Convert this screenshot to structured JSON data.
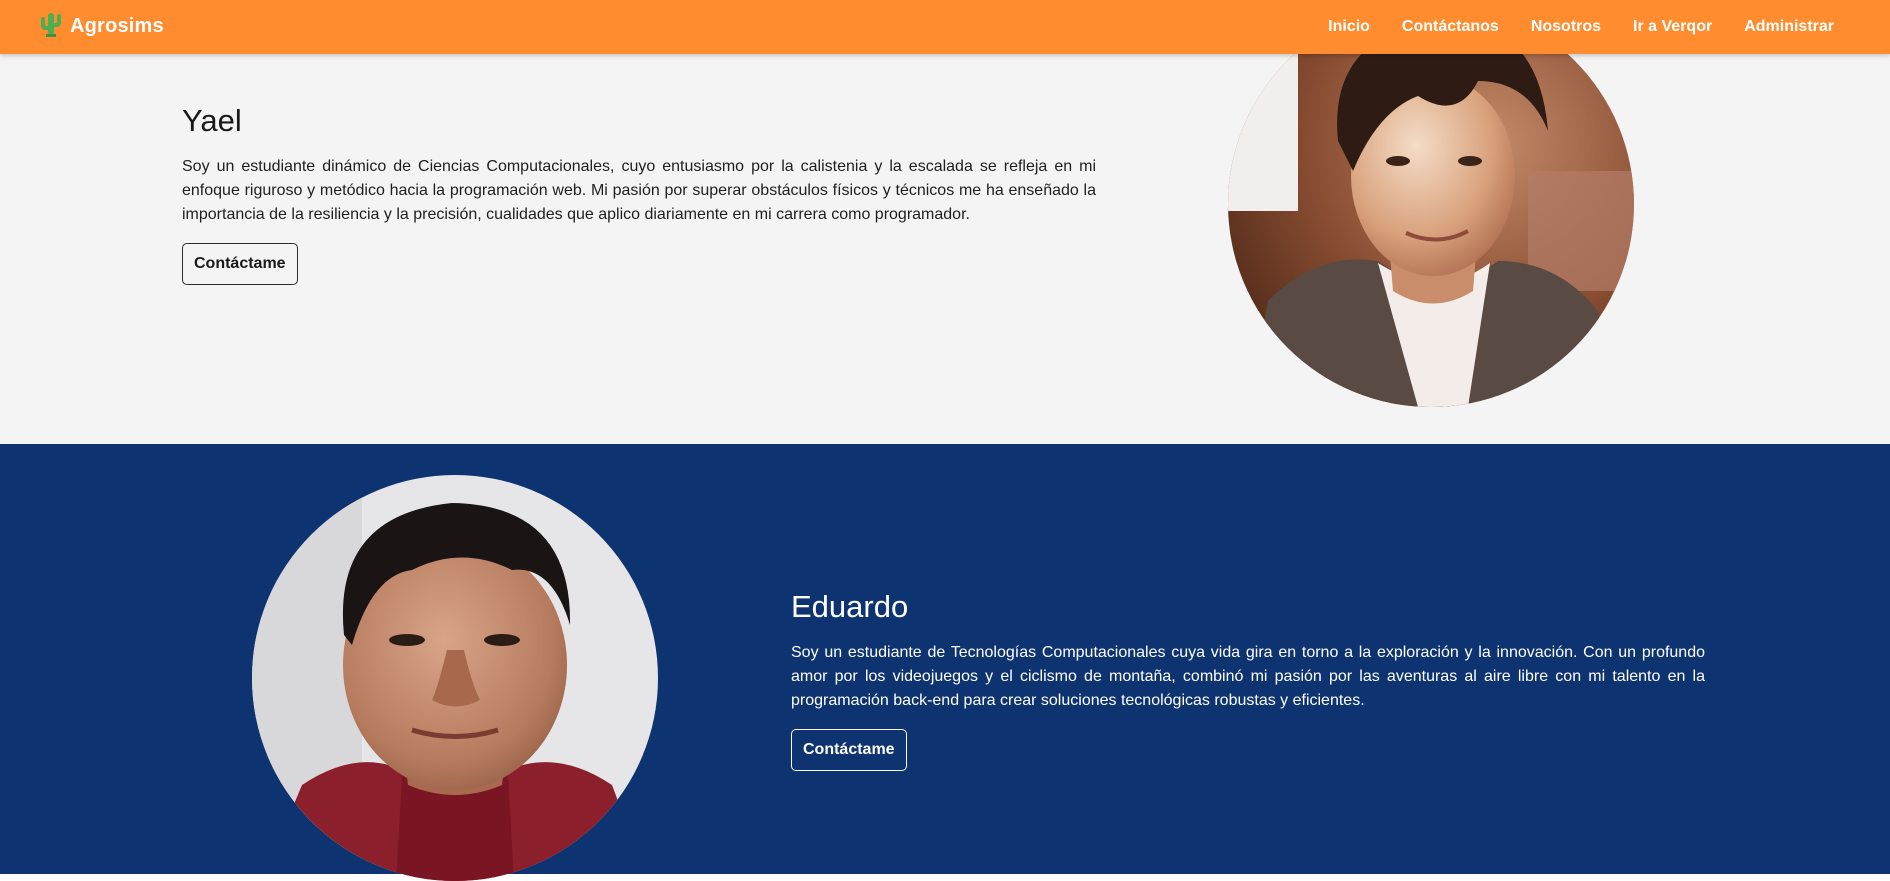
{
  "navbar": {
    "brand": "Agrosims",
    "brand_icon": "cactus-icon",
    "links": [
      "Inicio",
      "Contáctanos",
      "Nosotros",
      "Ir a Verqor",
      "Administrar"
    ]
  },
  "team": [
    {
      "name": "Yael",
      "bio": "Soy un estudiante dinámico de Ciencias Computacionales, cuyo entusiasmo por la calistenia y la escalada se refleja en mi enfoque riguroso y metódico hacia la programación web. Mi pasión por superar obstáculos físicos y técnicos me ha enseñado la importancia de la resiliencia y la precisión, cualidades que aplico diariamente en mi carrera como programador.",
      "button": "Contáctame"
    },
    {
      "name": "Eduardo",
      "bio": "Soy un estudiante de Tecnologías Computacionales cuya vida gira en torno a la exploración y la innovación. Con un profundo amor por los videojuegos y el ciclismo de montaña, combinó mi pasión por las aventuras al aire libre con mi talento en la programación back-end para crear soluciones tecnológicas robustas y eficientes.",
      "button": "Contáctame"
    }
  ],
  "colors": {
    "navbar": "#ff8c2e",
    "light_section": "#f4f4f4",
    "dark_section": "#0d3371",
    "brand_icon": "#4caf50"
  }
}
